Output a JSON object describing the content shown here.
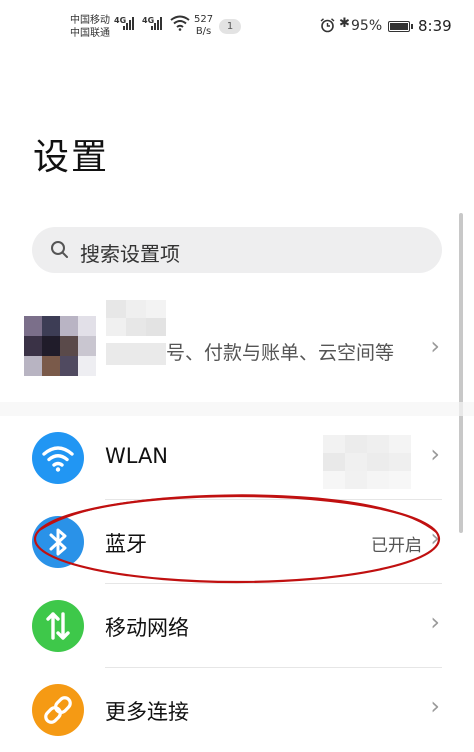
{
  "status_bar": {
    "carrier1": "中国移动",
    "carrier2": "中国联通",
    "network1": "4G",
    "network2": "4G",
    "speed_value": "527",
    "speed_unit": "B/s",
    "notification_count": "1",
    "battery_percent": "95%",
    "battery_level": 0.95,
    "time": "8:39"
  },
  "page": {
    "title": "设置"
  },
  "search": {
    "placeholder": "搜索设置项"
  },
  "account": {
    "description_visible": "号、付款与账单、云空间等"
  },
  "rows": [
    {
      "icon": "wifi-icon",
      "color": "#2196f3",
      "label": "WLAN",
      "value": ""
    },
    {
      "icon": "bluetooth-icon",
      "color": "#2a92e8",
      "label": "蓝牙",
      "value": "已开启"
    },
    {
      "icon": "mobile-data-icon",
      "color": "#3ec84a",
      "label": "移动网络",
      "value": ""
    },
    {
      "icon": "link-icon",
      "color": "#f59a14",
      "label": "更多连接",
      "value": ""
    }
  ],
  "annotation": {
    "color": "#c01010"
  }
}
